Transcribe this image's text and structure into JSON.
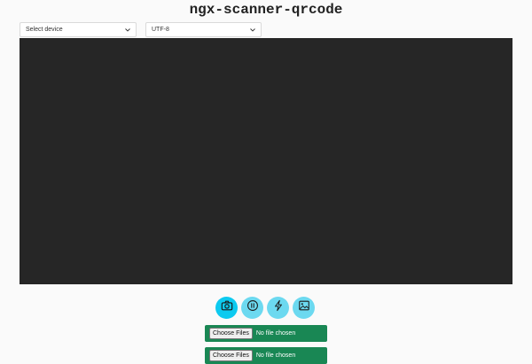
{
  "app": {
    "title": "ngx-scanner-qrcode"
  },
  "selects": {
    "device": {
      "value": "Select device",
      "icon": "chevron-down-icon"
    },
    "encoding": {
      "value": "UTF-8",
      "icon": "chevron-down-icon"
    }
  },
  "controls": [
    {
      "name": "camera",
      "icon": "camera-icon",
      "active": true
    },
    {
      "name": "pause",
      "icon": "pause-icon",
      "active": false
    },
    {
      "name": "torch",
      "icon": "flash-icon",
      "active": false
    },
    {
      "name": "image",
      "icon": "image-icon",
      "active": false
    }
  ],
  "file_inputs": [
    {
      "button_label": "Choose Files",
      "status": "No file chosen"
    },
    {
      "button_label": "Choose Files",
      "status": "No file chosen"
    }
  ],
  "colors": {
    "video_bg": "#262626",
    "control_active": "#0dcaf0",
    "control": "#6cd9f0",
    "file_bg": "#198754"
  }
}
